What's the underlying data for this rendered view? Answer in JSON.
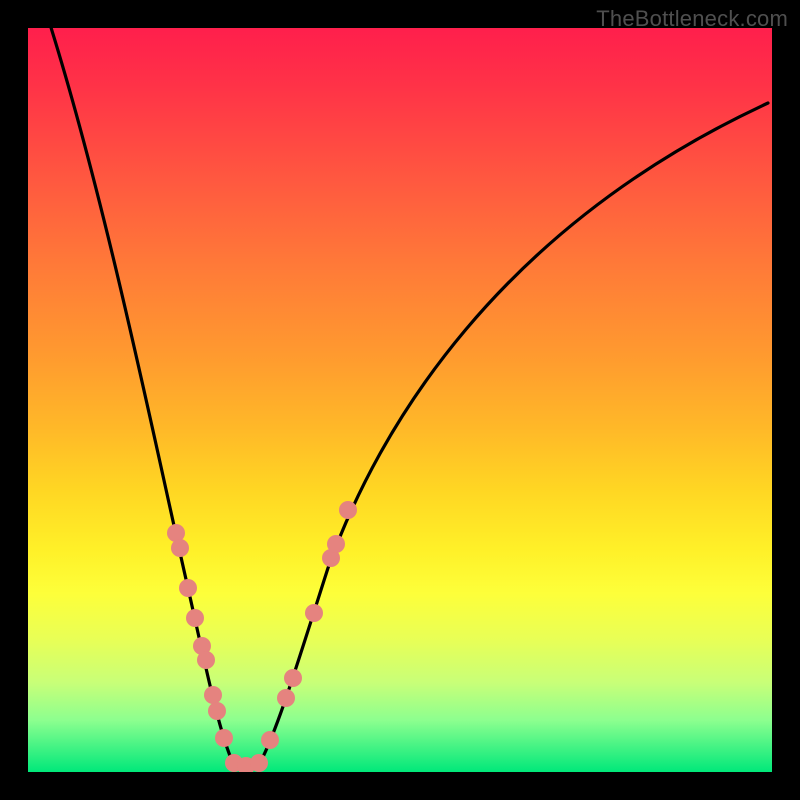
{
  "watermark": "TheBottleneck.com",
  "chart_data": {
    "type": "line",
    "title": "",
    "xlabel": "",
    "ylabel": "",
    "xlim": [
      0,
      100
    ],
    "ylim": [
      0,
      100
    ],
    "grid": false,
    "legend": false,
    "background_gradient": {
      "orientation": "vertical",
      "stops": [
        {
          "pos": 0,
          "color": "#ff1f4c"
        },
        {
          "pos": 50,
          "color": "#ffb928"
        },
        {
          "pos": 75,
          "color": "#fdff3a"
        },
        {
          "pos": 100,
          "color": "#00e87a"
        }
      ]
    },
    "series": [
      {
        "name": "left_curve",
        "x": [
          3,
          10,
          15,
          18,
          20,
          22,
          24,
          26,
          27.5
        ],
        "y": [
          101,
          75,
          42,
          25,
          15,
          8,
          4,
          1.5,
          0.5
        ]
      },
      {
        "name": "right_curve",
        "x": [
          27.5,
          29,
          31,
          35,
          40,
          50,
          65,
          85,
          100
        ],
        "y": [
          0.5,
          1,
          4,
          14,
          28,
          52,
          74,
          86,
          90
        ]
      }
    ],
    "markers": {
      "color": "#e5837f",
      "radius_px": 9,
      "points": [
        {
          "branch": "left",
          "x": 20.0,
          "y": 32
        },
        {
          "branch": "left",
          "x": 20.5,
          "y": 30
        },
        {
          "branch": "left",
          "x": 21.5,
          "y": 25
        },
        {
          "branch": "left",
          "x": 22.5,
          "y": 21
        },
        {
          "branch": "left",
          "x": 23.4,
          "y": 17
        },
        {
          "branch": "left",
          "x": 23.9,
          "y": 15
        },
        {
          "branch": "left",
          "x": 24.9,
          "y": 10
        },
        {
          "branch": "left",
          "x": 25.4,
          "y": 8
        },
        {
          "branch": "left",
          "x": 26.3,
          "y": 5
        },
        {
          "branch": "valley",
          "x": 27.7,
          "y": 1.2
        },
        {
          "branch": "valley",
          "x": 29.3,
          "y": 0.8
        },
        {
          "branch": "valley",
          "x": 31.0,
          "y": 1.2
        },
        {
          "branch": "right",
          "x": 32.5,
          "y": 4
        },
        {
          "branch": "right",
          "x": 34.7,
          "y": 10
        },
        {
          "branch": "right",
          "x": 35.6,
          "y": 13
        },
        {
          "branch": "right",
          "x": 38.4,
          "y": 21
        },
        {
          "branch": "right",
          "x": 40.7,
          "y": 29
        },
        {
          "branch": "right",
          "x": 41.4,
          "y": 31
        },
        {
          "branch": "right",
          "x": 43.0,
          "y": 35
        }
      ]
    },
    "notes": "V-shaped bottleneck curve over rainbow heat gradient. Axes and tick labels are not rendered in the source image; x/y values are estimated on a 0–100 normalized scale where y=0 is the bottom (green / optimal) and y=100 is the top (red / severe bottleneck). The curve minimum (optimal match) sits near x≈29."
  }
}
